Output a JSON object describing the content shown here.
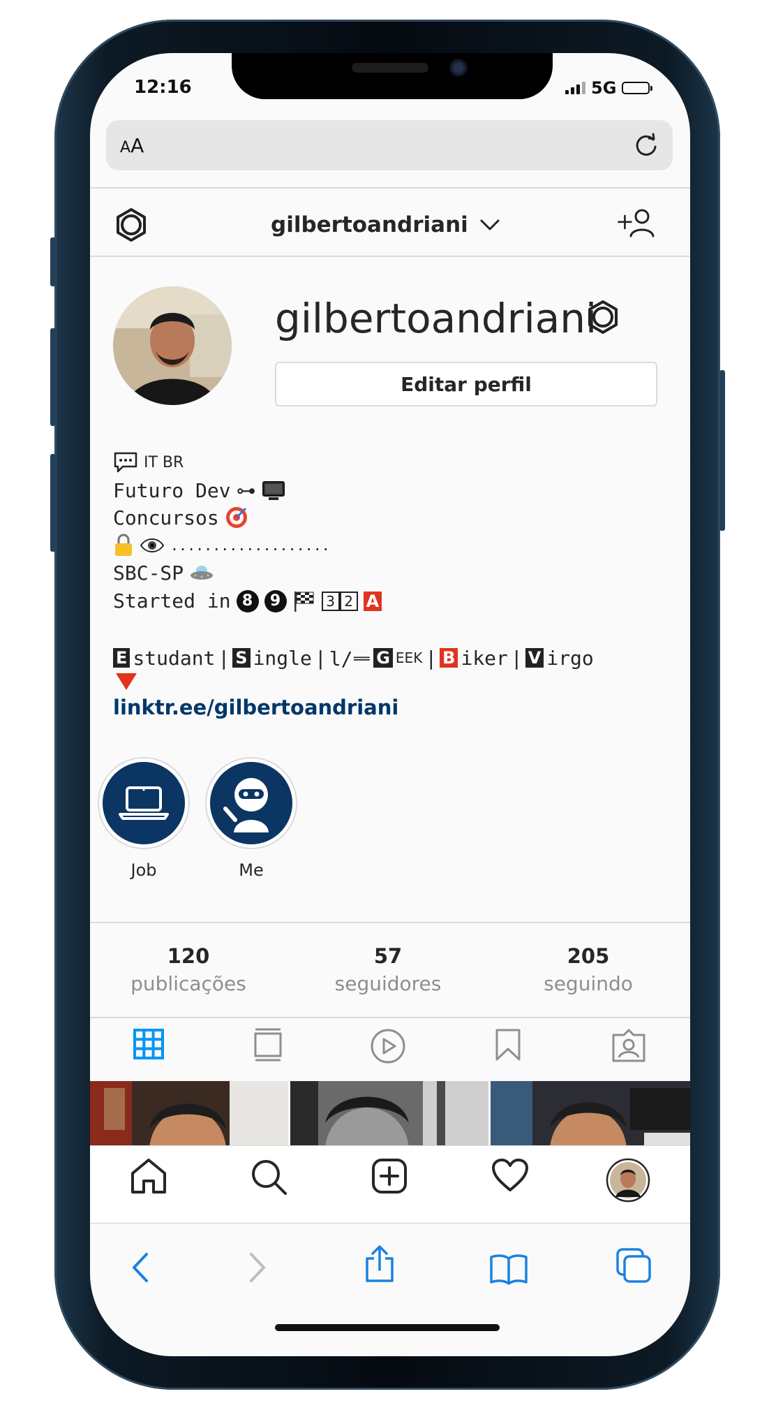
{
  "status": {
    "time": "12:16",
    "network": "5G"
  },
  "browser": {
    "text_size_label_small": "A",
    "text_size_label_big": "A"
  },
  "header": {
    "username": "gilbertoandriani"
  },
  "profile": {
    "display_name": "gilbertoandriani",
    "edit_button": "Editar perfil"
  },
  "bio": {
    "line1_text": "IT BR",
    "line2_text": "Futuro Dev",
    "line2_key": "⊶",
    "line3_text": "Concursos",
    "line4_dots": "...................",
    "line5_text": "SBC-SP",
    "line6_text": "Started in",
    "line6_n1": "8",
    "line6_n2": "9",
    "line6_b1": "3",
    "line6_b2": "2",
    "line6_b3": "A",
    "line7": {
      "e": "E",
      "e_rest": "studant",
      "s": "S",
      "s_rest": "ingle",
      "sep": "|",
      "l_part": "l/ᆖ",
      "g": "G",
      "g_rest": "EEK",
      "b": "B",
      "b_rest": "iker",
      "v": "V",
      "v_rest": "irgo"
    },
    "link": "linktr.ee/gilbertoandriani"
  },
  "highlights": [
    {
      "label": "Job"
    },
    {
      "label": "Me"
    }
  ],
  "stats": [
    {
      "value": "120",
      "label": "publicações"
    },
    {
      "value": "57",
      "label": "seguidores"
    },
    {
      "value": "205",
      "label": "seguindo"
    }
  ],
  "colors": {
    "accent": "#0095f6",
    "link": "#00376b",
    "highlight_bg": "#0b3563",
    "muted": "#8e8e8e",
    "safari_blue": "#1a82e2"
  },
  "icons": {
    "header_left": "gear-icon",
    "header_right": "add-user-icon",
    "tabs": [
      "grid-icon",
      "feed-icon",
      "reels-icon",
      "saved-icon",
      "tagged-icon"
    ],
    "bottom_nav": [
      "home-icon",
      "search-icon",
      "new-post-icon",
      "heart-icon",
      "profile-avatar"
    ],
    "safari": [
      "back-icon",
      "forward-icon",
      "share-icon",
      "bookmarks-icon",
      "tabs-icon"
    ]
  }
}
